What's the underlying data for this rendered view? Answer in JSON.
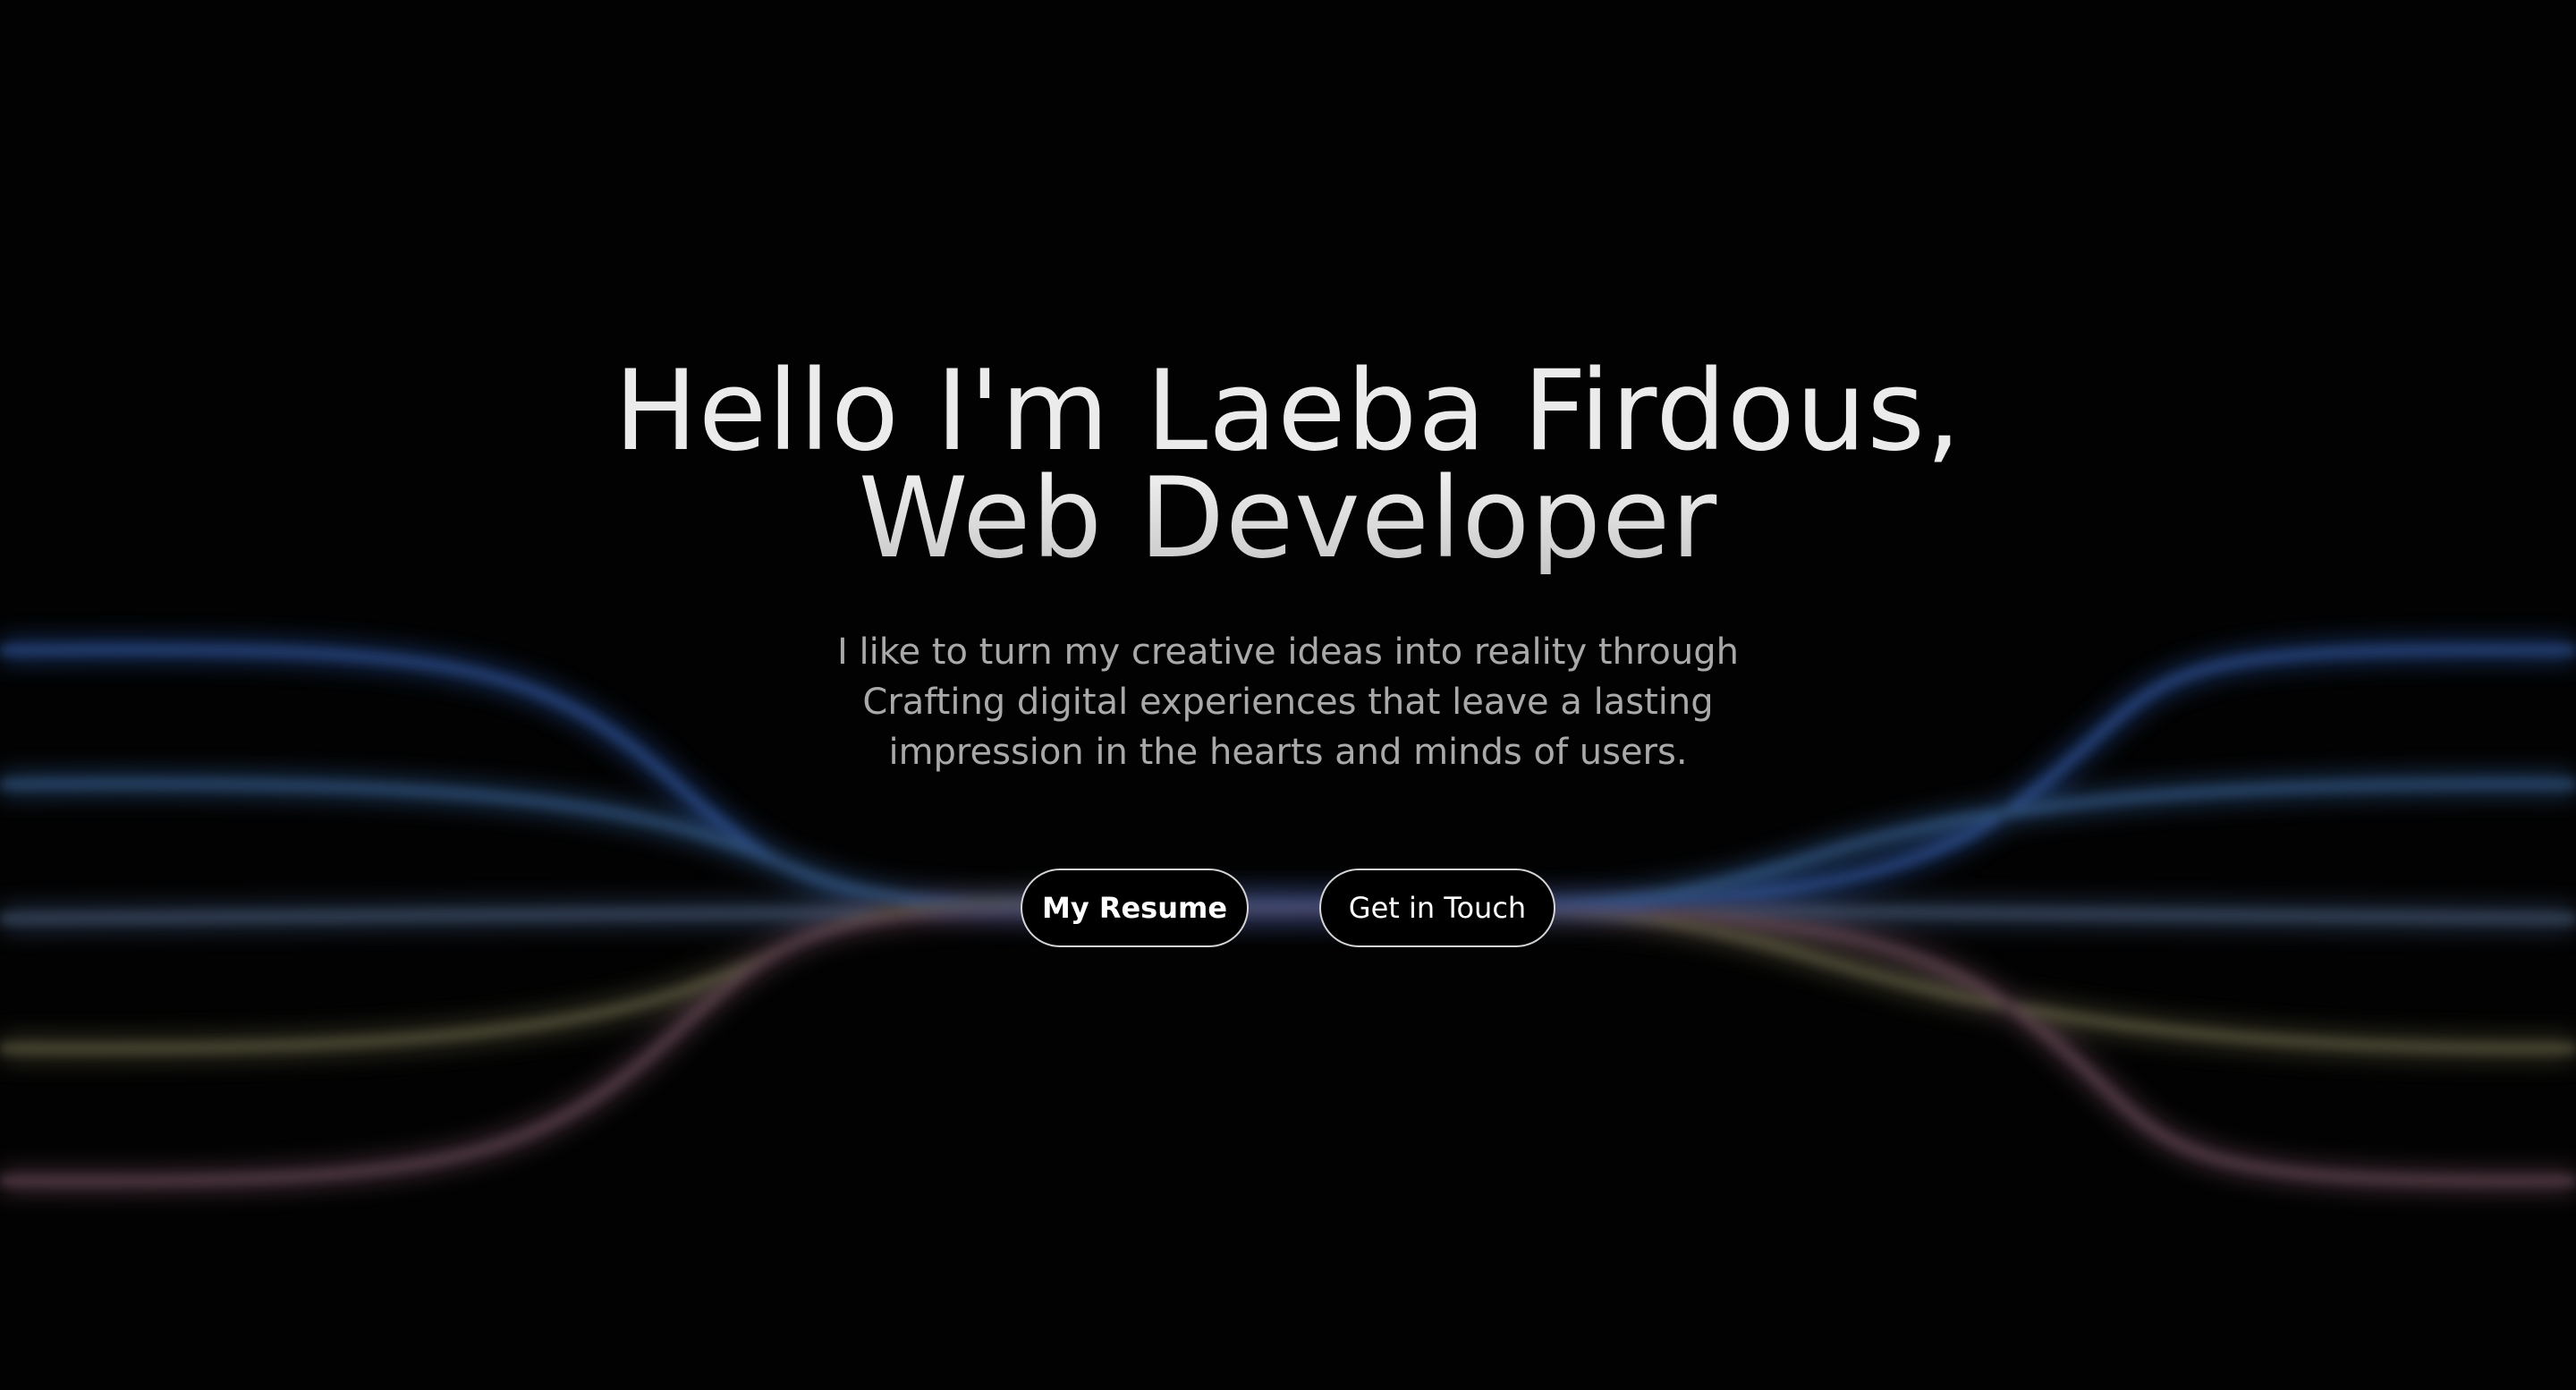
{
  "hero": {
    "headline_line1": "Hello I'm Laeba Firdous,",
    "headline_line2": "Web Developer",
    "subtitle_line1": "I like to turn my creative ideas into reality through",
    "subtitle_line2": "Crafting digital experiences that leave a lasting",
    "subtitle_line3": "impression in the hearts and minds of users.",
    "buttons": {
      "resume_label": "My Resume",
      "contact_label": "Get in Touch"
    }
  },
  "theme": {
    "background": "#020202",
    "text_primary": "#ebebeb",
    "text_secondary": "#a9a9a9",
    "button_border": "#d4d4d4",
    "line_colors": [
      "#3a5ea8",
      "#3d5c8e",
      "#4a5a78",
      "#6b6a55",
      "#6e5360"
    ]
  }
}
